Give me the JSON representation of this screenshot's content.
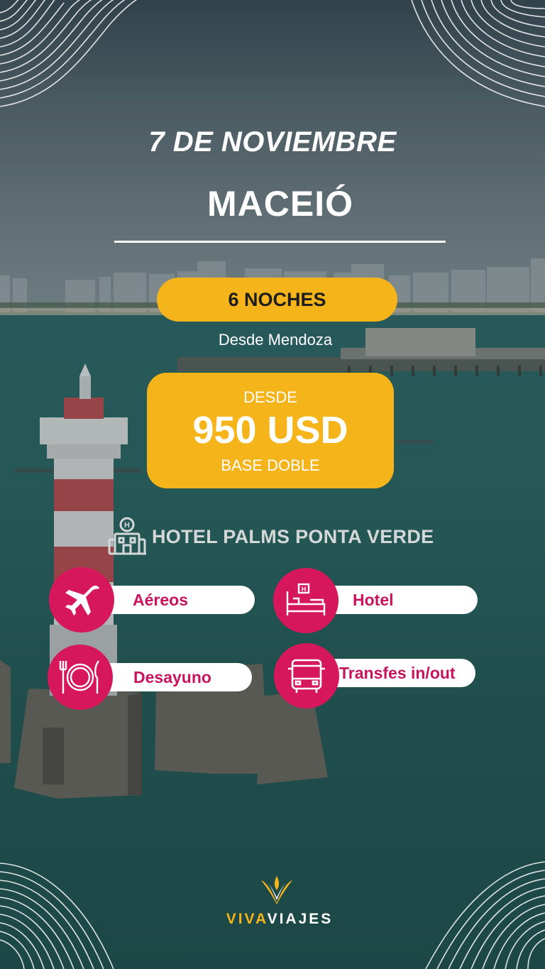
{
  "date": "7 DE NOVIEMBRE",
  "destination": "MACEIÓ",
  "nights": "6 NOCHES",
  "origin": "Desde Mendoza",
  "price": {
    "from_label": "DESDE",
    "value": "950 USD",
    "base_label": "BASE DOBLE"
  },
  "hotel": {
    "icon": "hotel-building-icon",
    "name": "HOTEL PALMS PONTA VERDE"
  },
  "includes": [
    {
      "label": "Aéreos",
      "icon": "airplane-icon"
    },
    {
      "label": "Hotel",
      "icon": "bed-icon"
    },
    {
      "label": "Desayuno",
      "icon": "plate-cutlery-icon"
    },
    {
      "label": "Transfes in/out",
      "icon": "bus-icon"
    }
  ],
  "brand": {
    "part1": "VIVA",
    "part2": "VIAJES",
    "icon": "viva-viajes-logo-icon"
  },
  "colors": {
    "accent_yellow": "#f4b41a",
    "accent_pink": "#d6175c",
    "pill_text": "#c8145e"
  }
}
